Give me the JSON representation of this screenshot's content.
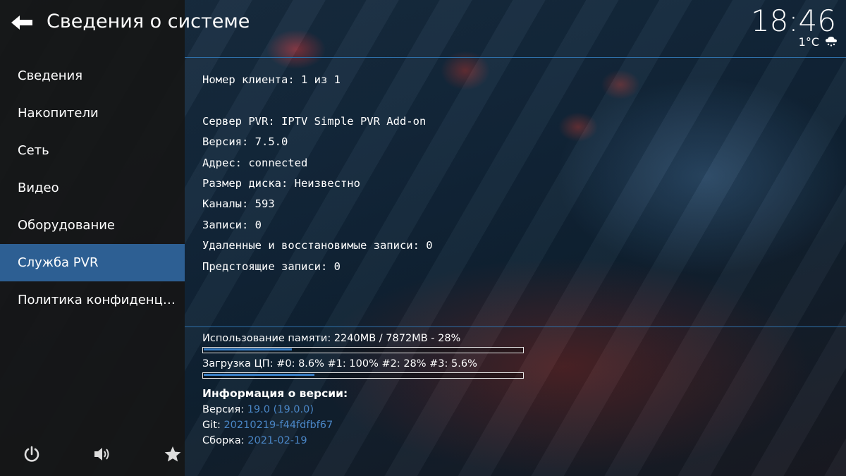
{
  "header": {
    "title": "Сведения о системе",
    "clock": "18:46",
    "temperature": "1°C",
    "weather_icon": "cloud-snow-icon"
  },
  "sidebar": {
    "items": [
      {
        "label": "Сведения",
        "active": false
      },
      {
        "label": "Накопители",
        "active": false
      },
      {
        "label": "Сеть",
        "active": false
      },
      {
        "label": "Видео",
        "active": false
      },
      {
        "label": "Оборудование",
        "active": false
      },
      {
        "label": "Служба PVR",
        "active": true
      },
      {
        "label": "Политика конфиденц…",
        "active": false
      }
    ],
    "bottom_icons": [
      "power-icon",
      "volume-icon",
      "star-icon"
    ]
  },
  "pvr_info": {
    "client": "Номер клиента: 1 из 1",
    "lines": [
      "Сервер PVR: IPTV Simple PVR Add-on",
      "Версия: 7.5.0",
      "Адрес: connected",
      "Размер диска: Неизвестно",
      "Каналы: 593",
      "Записи: 0",
      "Удаленные и восстановимые записи: 0",
      "Предстоящие записи: 0"
    ]
  },
  "stats": {
    "memory_label": "Использование памяти: 2240MB / 7872MB - 28%",
    "memory_fraction": 0.28,
    "cpu_label": "Загрузка ЦП: #0: 8.6% #1: 100% #2:  28% #3: 5.6%",
    "cpu_fraction": 0.35
  },
  "version_info": {
    "title": "Информация о версии:",
    "version_label": "Версия:",
    "version_value": "19.0 (19.0.0)",
    "git_label": "Git:",
    "git_value": "20210219-f44fdfbf67",
    "build_label": "Сборка:",
    "build_value": "2021-02-19"
  },
  "colors": {
    "accent": "#2d5f93",
    "link": "#4a86c6",
    "bar_fill": "#3a7fc6"
  }
}
